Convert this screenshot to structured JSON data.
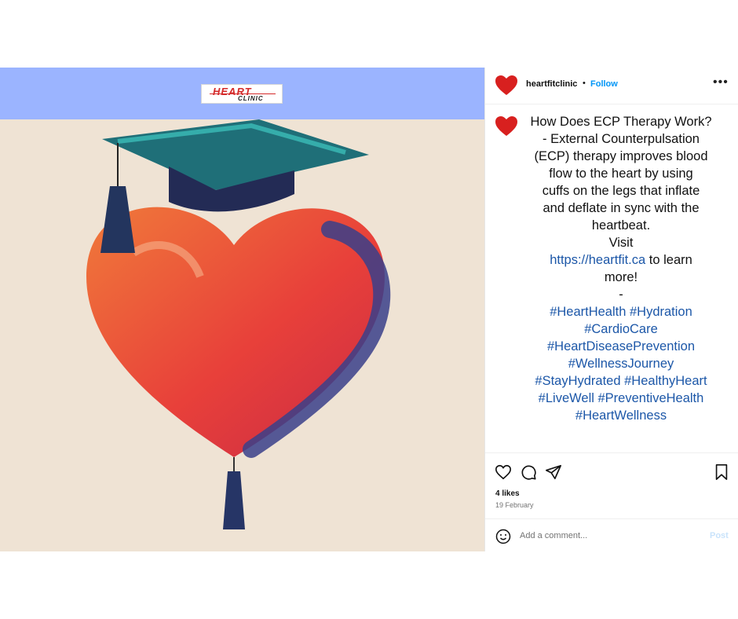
{
  "banner": {
    "logo_top": "HEART",
    "logo_bottom": "CLINIC"
  },
  "header": {
    "username": "heartfitclinic",
    "separator": "•",
    "follow_label": "Follow",
    "more_label": "•••"
  },
  "caption": {
    "line1": "How Does ECP Therapy Work?",
    "line2": "- External Counterpulsation",
    "line3": "(ECP) therapy improves blood",
    "line4": "flow to the heart by using",
    "line5": "cuffs on the legs that inflate",
    "line6": "and deflate in sync with the",
    "line7": "heartbeat.",
    "line8": "Visit",
    "link": "https://heartfit.ca",
    "link_suffix": " to learn",
    "line9b": "more!",
    "line10": "-",
    "hashtags": [
      "#HeartHealth #Hydration",
      "#CardioCare",
      "#HeartDiseasePrevention",
      "#WellnessJourney",
      "#StayHydrated #HealthyHeart",
      "#LiveWell #PreventiveHealth",
      "#HeartWellness"
    ]
  },
  "stats": {
    "likes": "4 likes",
    "date": "19 February"
  },
  "comment": {
    "placeholder": "Add a comment...",
    "post_label": "Post"
  },
  "colors": {
    "banner": "#9bb4ff",
    "follow": "#0095f6",
    "link": "#1c57a8",
    "heart": "#e0302c"
  }
}
